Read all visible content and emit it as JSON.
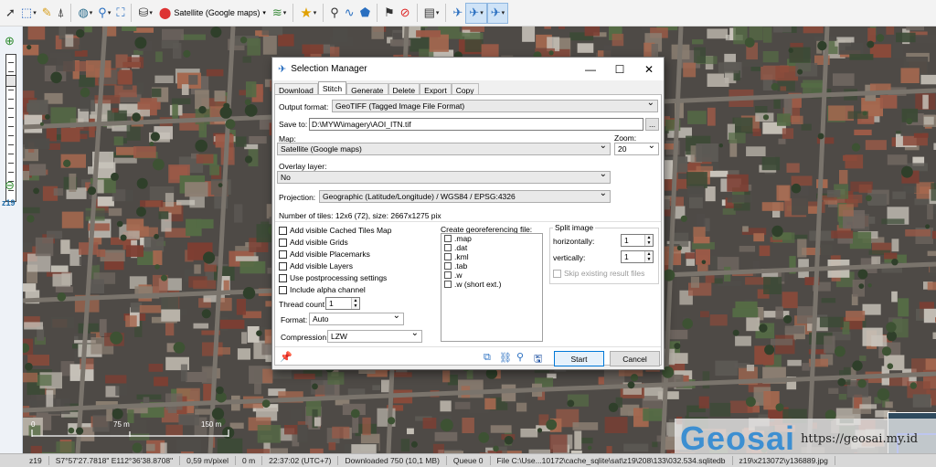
{
  "toolbar": {
    "map_source": "Satellite (Google maps)"
  },
  "left": {
    "zoom_label": "z19"
  },
  "map": {
    "scale_label_1": "75 m",
    "scale_label_2": "150 m",
    "scale_label_0": "0",
    "watermark_logo": "Geosai",
    "watermark_url": "https://geosai.my.id"
  },
  "status": {
    "zoom": "z19",
    "coords": "S7°57'27.7818\" E112°36'38.8708\"",
    "resolution": "0,59 m/pixel",
    "altitude": "0 m",
    "time": "22:37:02 (UTC+7)",
    "downloaded": "Downloaded 750 (10,1 MB)",
    "queue": "Queue 0",
    "file": "File C:\\Use...10172\\cache_sqlite\\sat\\z19\\208\\133\\032.534.sqlitedb",
    "tile": "z19\\x213072\\y136889.jpg"
  },
  "dialog": {
    "title": "Selection Manager",
    "tabs": [
      "Download",
      "Stitch",
      "Generate",
      "Delete",
      "Export",
      "Copy"
    ],
    "output_format_label": "Output format:",
    "output_format_value": "GeoTIFF (Tagged Image File Format)",
    "save_to_label": "Save to:",
    "save_to_value": "D:\\MYW\\imagery\\AOI_ITN.tif",
    "browse_label": "...",
    "map_label": "Map:",
    "map_value": "Satellite (Google maps)",
    "zoom_label": "Zoom:",
    "zoom_value": "20",
    "overlay_label": "Overlay layer:",
    "overlay_value": "No",
    "projection_label": "Projection:",
    "projection_value": "Geographic (Latitude/Longitude) / WGS84 / EPSG:4326",
    "tiles_info": "Number of tiles: 12x6 (72), size: 2667x1275 pix",
    "options": [
      "Add visible Cached Tiles Map",
      "Add visible Grids",
      "Add visible Placemarks",
      "Add visible Layers",
      "Use postprocessing settings",
      "Include alpha channel"
    ],
    "thread_count_label": "Thread count",
    "thread_count_value": "1",
    "format_label": "Format:",
    "format_value": "Auto",
    "compression_label": "Compression:",
    "compression_value": "LZW",
    "georef_label": "Create georeferencing file:",
    "georef_items": [
      ".map",
      ".dat",
      ".kml",
      ".tab",
      ".w",
      ".w (short ext.)"
    ],
    "split_label": "Split image",
    "horizontally_label": "horizontally:",
    "horizontally_value": "1",
    "vertically_label": "vertically:",
    "vertically_value": "1",
    "skip_label": "Skip existing result files",
    "start_label": "Start",
    "cancel_label": "Cancel"
  }
}
